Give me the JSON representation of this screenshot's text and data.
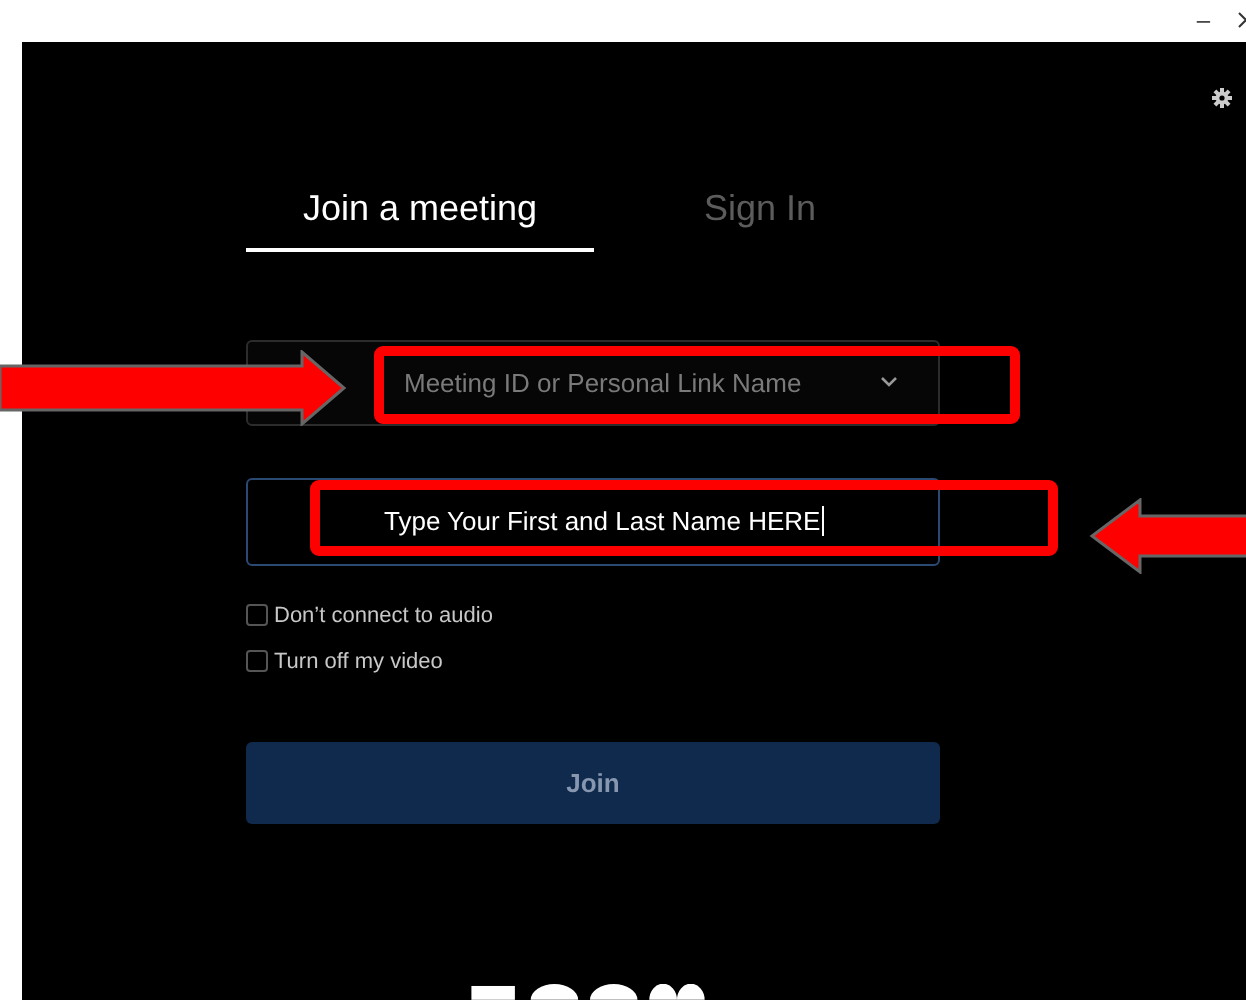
{
  "window": {
    "minimize": "–"
  },
  "tabs": [
    {
      "label": "Join a meeting",
      "selected": true
    },
    {
      "label": "Sign In",
      "selected": false
    }
  ],
  "meeting_id": {
    "placeholder": "Meeting ID or Personal Link Name"
  },
  "name_field": {
    "value": "Type Your First and Last Name HERE",
    "focused": true
  },
  "options": [
    {
      "label": "Don’t connect to audio",
      "checked": false
    },
    {
      "label": "Turn off my video",
      "checked": false
    }
  ],
  "join_button": {
    "label": "Join",
    "disabled": true
  },
  "annotations": [
    {
      "kind": "arrow-right"
    },
    {
      "kind": "box"
    },
    {
      "kind": "box"
    },
    {
      "kind": "arrow-left"
    }
  ]
}
